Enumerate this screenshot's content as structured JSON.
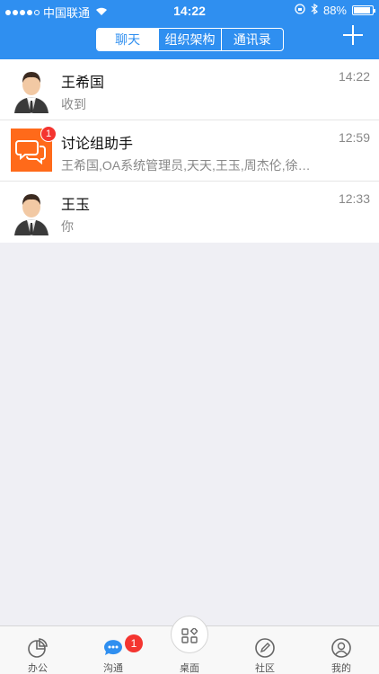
{
  "status_bar": {
    "carrier": "中国联通",
    "time": "14:22",
    "battery": "88%",
    "battery_level": 0.88
  },
  "header": {
    "tabs": [
      {
        "label": "聊天",
        "active": true
      },
      {
        "label": "组织架构",
        "active": false
      },
      {
        "label": "通讯录",
        "active": false
      }
    ],
    "add_icon": "plus-icon"
  },
  "conversations": [
    {
      "name": "王希国",
      "time": "14:22",
      "preview": "收到",
      "avatar": "person-avatar"
    },
    {
      "name": "讨论组助手",
      "time": "12:59",
      "preview": "王希国,OA系统管理员,天天,王玉,周杰伦,徐…",
      "avatar": "group-chat-icon",
      "badge": "1"
    },
    {
      "name": "王玉",
      "time": "12:33",
      "preview": "你",
      "avatar": "person-avatar"
    }
  ],
  "tabbar": {
    "items": [
      {
        "label": "办公",
        "icon": "pie-chart-icon"
      },
      {
        "label": "沟通",
        "icon": "chat-bubble-icon",
        "badge": "1"
      },
      {
        "label": "桌面",
        "icon": "grid-icon"
      },
      {
        "label": "社区",
        "icon": "pencil-icon"
      },
      {
        "label": "我的",
        "icon": "user-icon"
      }
    ]
  },
  "colors": {
    "brand_blue": "#2f8ff0",
    "badge_red": "#f43530",
    "group_orange": "#ff6a1a"
  }
}
